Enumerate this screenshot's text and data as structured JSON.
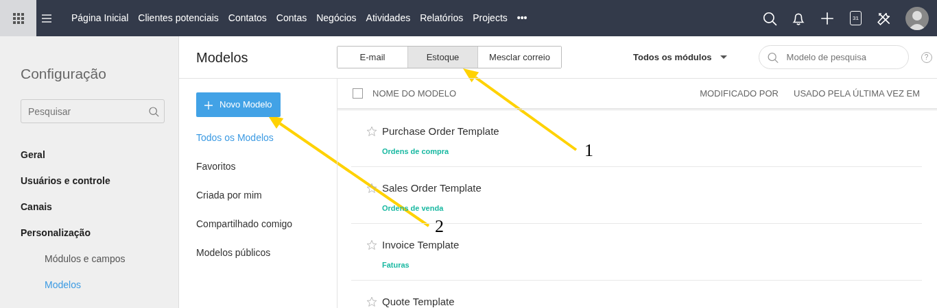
{
  "topbar": {
    "nav": [
      {
        "label": "Página Inicial"
      },
      {
        "label": "Clientes potenciais"
      },
      {
        "label": "Contatos"
      },
      {
        "label": "Contas"
      },
      {
        "label": "Negócios"
      },
      {
        "label": "Atividades"
      },
      {
        "label": "Relatórios"
      },
      {
        "label": "Projects"
      },
      {
        "label": "•••"
      }
    ],
    "calendar_day": "31"
  },
  "sidebar": {
    "title": "Configuração",
    "search": {
      "placeholder": "Pesquisar"
    },
    "items": [
      {
        "label": "Geral",
        "kind": "section",
        "selected": false
      },
      {
        "label": "Usuários e controle",
        "kind": "section",
        "selected": false
      },
      {
        "label": "Canais",
        "kind": "section",
        "selected": false
      },
      {
        "label": "Personalização",
        "kind": "section",
        "selected": false
      },
      {
        "label": "Módulos e campos",
        "kind": "sub",
        "selected": false
      },
      {
        "label": "Modelos",
        "kind": "sub",
        "selected": true
      }
    ]
  },
  "page": {
    "title": "Modelos",
    "tabs": [
      {
        "label": "E-mail",
        "selected": false
      },
      {
        "label": "Estoque",
        "selected": true
      },
      {
        "label": "Mesclar correio",
        "selected": false
      }
    ],
    "module_filter": "Todos os módulos",
    "search": {
      "placeholder": "Modelo de pesquisa"
    },
    "help": "?"
  },
  "folders": {
    "new_button": "Novo Modelo",
    "items": [
      {
        "label": "Todos os Modelos",
        "selected": true
      },
      {
        "label": "Favoritos",
        "selected": false
      },
      {
        "label": "Criada por mim",
        "selected": false
      },
      {
        "label": "Compartilhado comigo",
        "selected": false
      },
      {
        "label": "Modelos públicos",
        "selected": false
      }
    ]
  },
  "table": {
    "select_all": {
      "checked": false
    },
    "columns": [
      "NOME DO MODELO",
      "MODIFICADO POR",
      "USADO PELA ÚLTIMA VEZ EM"
    ],
    "rows": [
      {
        "name": "Purchase Order Template",
        "module": "Ordens de compra",
        "favorite": false
      },
      {
        "name": "Sales Order Template",
        "module": "Ordens de venda",
        "favorite": false
      },
      {
        "name": "Invoice Template",
        "module": "Faturas",
        "favorite": false
      },
      {
        "name": "Quote Template",
        "favorite": false
      }
    ]
  },
  "annotations": [
    {
      "label": "1"
    },
    {
      "label": "2"
    }
  ]
}
